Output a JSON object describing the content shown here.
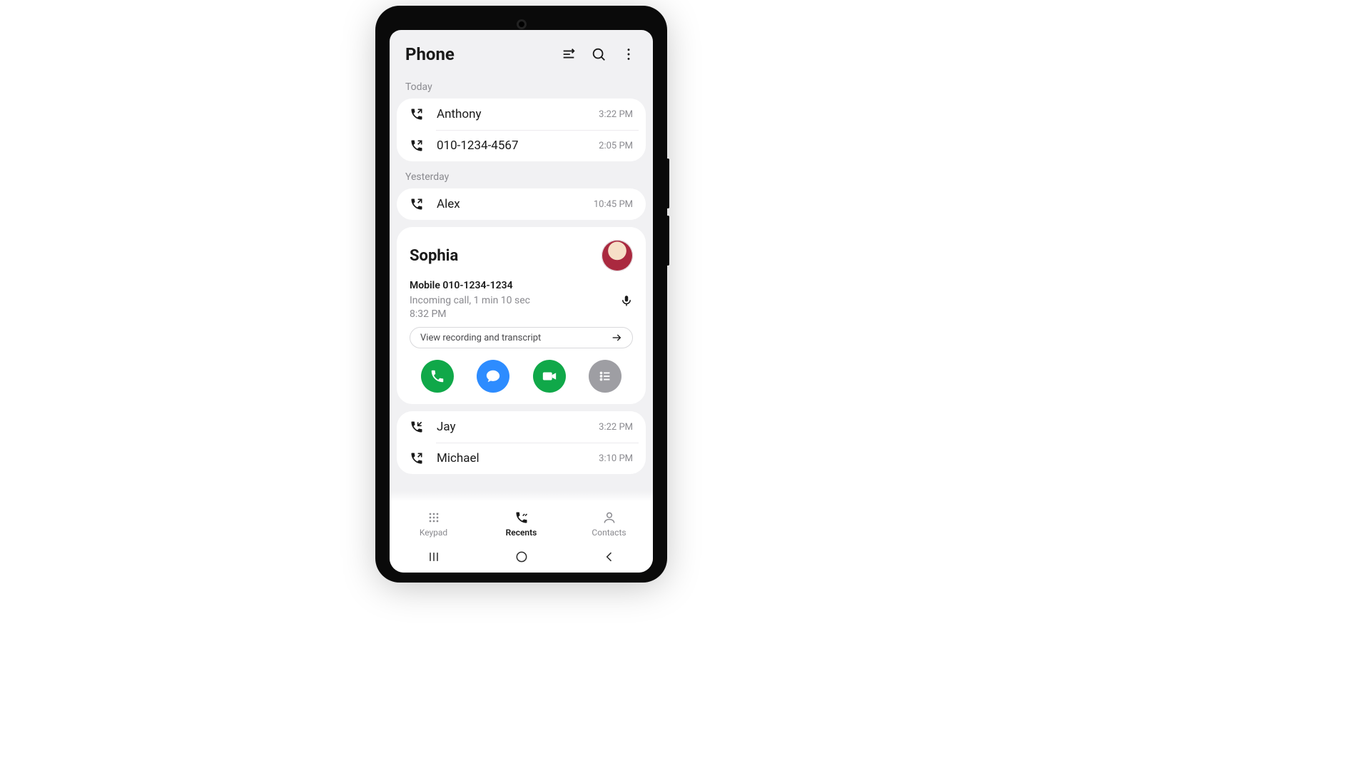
{
  "header": {
    "title": "Phone"
  },
  "sections": {
    "today_label": "Today",
    "yesterday_label": "Yesterday"
  },
  "calls_today": [
    {
      "name": "Anthony",
      "time": "3:22 PM",
      "direction": "outgoing"
    },
    {
      "name": "010-1234-4567",
      "time": "2:05 PM",
      "direction": "outgoing"
    }
  ],
  "calls_yesterday_1": [
    {
      "name": "Alex",
      "time": "10:45 PM",
      "direction": "outgoing"
    }
  ],
  "expanded": {
    "name": "Sophia",
    "phone": "Mobile 010-1234-1234",
    "summary": "Incoming call, 1 min 10 sec",
    "time": "8:32 PM",
    "transcript_label": "View recording and transcript"
  },
  "calls_yesterday_2": [
    {
      "name": "Jay",
      "time": "3:22 PM",
      "direction": "incoming"
    },
    {
      "name": "Michael",
      "time": "3:10 PM",
      "direction": "outgoing"
    }
  ],
  "tabbar": {
    "keypad": "Keypad",
    "recents": "Recents",
    "contacts": "Contacts"
  }
}
